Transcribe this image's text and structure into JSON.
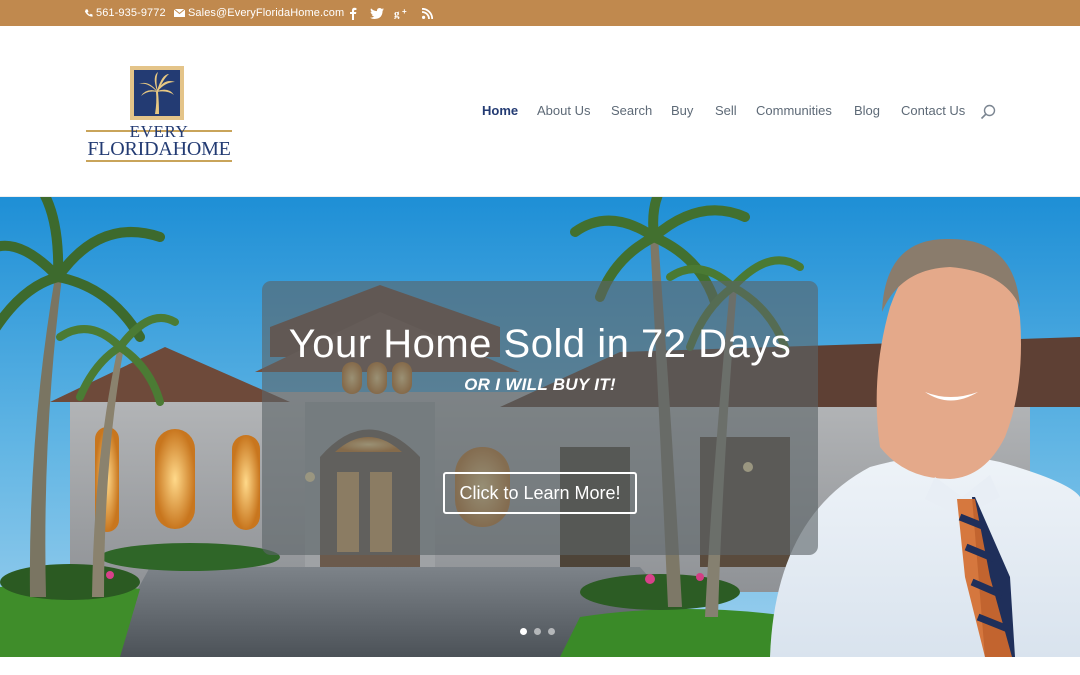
{
  "topbar": {
    "phone": "561-935-9772",
    "email": "Sales@EveryFloridaHome.com",
    "social_icons": [
      "facebook-icon",
      "twitter-icon",
      "google-plus-icon",
      "rss-icon"
    ],
    "background": "#c0894e"
  },
  "logo": {
    "line1": "EVERY",
    "line2": "FLORIDAHOME",
    "emblem": "palm-tree-icon",
    "color": "#233b73",
    "accent": "#c9a45a"
  },
  "nav": {
    "items": [
      "Home",
      "About Us",
      "Search",
      "Buy",
      "Sell",
      "Communities",
      "Blog",
      "Contact Us"
    ],
    "active": "Home",
    "active_color": "#233b73"
  },
  "hero": {
    "title": "Your Home Sold in 72 Days",
    "subtitle": "OR I WILL BUY IT!",
    "cta": "Click to Learn More!",
    "slides": 3,
    "active_slide": 1
  }
}
